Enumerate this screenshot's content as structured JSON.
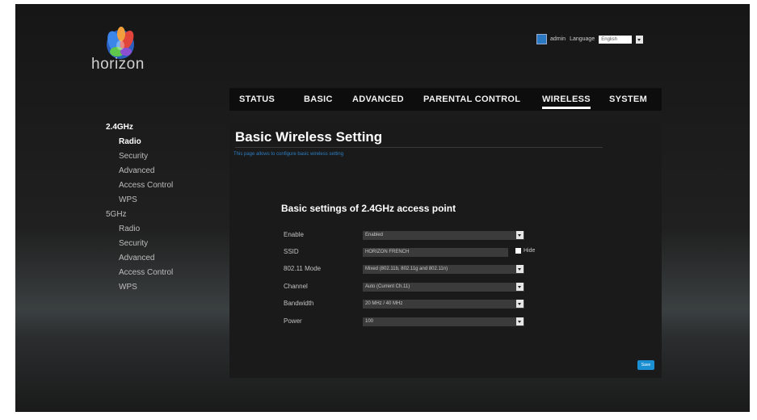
{
  "header": {
    "logo_text": "horizon",
    "user": "admin",
    "language_label": "Language",
    "language_value": "English"
  },
  "nav": {
    "tabs": [
      {
        "label": "STATUS"
      },
      {
        "label": "BASIC"
      },
      {
        "label": "ADVANCED"
      },
      {
        "label": "PARENTAL CONTROL"
      },
      {
        "label": "WIRELESS"
      },
      {
        "label": "SYSTEM"
      }
    ],
    "active": "WIRELESS"
  },
  "sidebar": {
    "band_24": "2.4GHz",
    "items_24": [
      "Radio",
      "Security",
      "Advanced",
      "Access Control",
      "WPS"
    ],
    "band_5": "5GHz",
    "items_5": [
      "Radio",
      "Security",
      "Advanced",
      "Access Control",
      "WPS"
    ],
    "selected": "Radio"
  },
  "main": {
    "title": "Basic Wireless Setting",
    "subtitle": "This page allows to configure basic wireless setting",
    "section_title": "Basic settings of 2.4GHz access point",
    "fields": [
      {
        "label": "Enable",
        "value": "Enabled"
      },
      {
        "label": "SSID",
        "value": "HORIZON FRENCH"
      },
      {
        "label": "802.11 Mode",
        "value": "Mixed (802.11b, 802.11g and 802.11n)"
      },
      {
        "label": "Channel",
        "value": "Auto (Current Ch.11)"
      },
      {
        "label": "Bandwidth",
        "value": "20 MHz / 40 MHz"
      },
      {
        "label": "Power",
        "value": "100"
      }
    ],
    "hide_label": "Hide",
    "save_label": "Save"
  },
  "colors": {
    "accent": "#1a8fd1",
    "link": "#2d7fc4",
    "background": "#1a1a1a"
  }
}
